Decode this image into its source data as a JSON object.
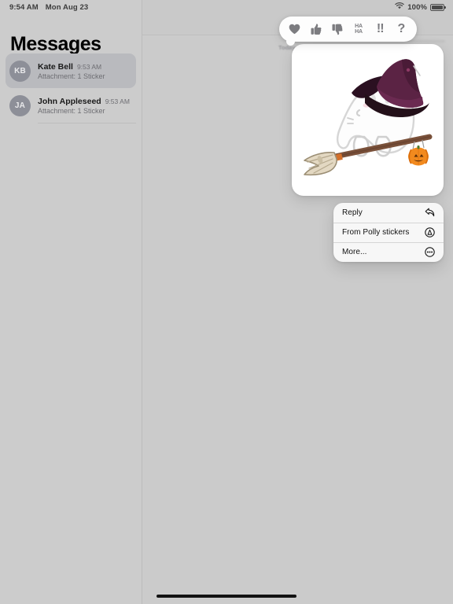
{
  "status_bar": {
    "time": "9:54 AM",
    "date": "Mon Aug 23",
    "battery_percent": "100%",
    "wifi_icon": "wifi-icon",
    "battery_icon": "battery-full-icon"
  },
  "sidebar": {
    "title": "Messages",
    "conversations": [
      {
        "initials": "KB",
        "name": "Kate Bell",
        "time": "9:53 AM",
        "preview": "Attachment: 1 Sticker",
        "selected": true
      },
      {
        "initials": "JA",
        "name": "John Appleseed",
        "time": "9:53 AM",
        "preview": "Attachment: 1 Sticker",
        "selected": false
      }
    ]
  },
  "conversation": {
    "day_stamp": "Today"
  },
  "tapback_bar": {
    "options": [
      {
        "id": "heart",
        "icon": "heart-icon",
        "label": "Love"
      },
      {
        "id": "thumbsup",
        "icon": "thumbs-up-icon",
        "label": "Like"
      },
      {
        "id": "thumbsdown",
        "icon": "thumbs-down-icon",
        "label": "Dislike"
      },
      {
        "id": "haha",
        "icon": "haha-icon",
        "line1": "HA",
        "line2": "HA",
        "label": "Haha"
      },
      {
        "id": "exclamation",
        "icon": "double-exclamation-icon",
        "glyph": "!!",
        "label": "Emphasize"
      },
      {
        "id": "question",
        "icon": "question-mark-icon",
        "glyph": "?",
        "label": "Question"
      }
    ]
  },
  "sticker": {
    "description": "ghost wearing purple witch hat riding broomstick with pumpkin",
    "colors": {
      "hat_crown": "#5b2344",
      "hat_brim": "#2a1020",
      "ghost_body": "#fdfdfd",
      "ghost_outline": "#d2d2d2",
      "broom_handle": "#7a513a",
      "broom_bristles": "#ded2bd",
      "pumpkin": "#f28a1e",
      "pumpkin_dark": "#d96d0d"
    }
  },
  "context_menu": {
    "items": [
      {
        "label": "Reply",
        "icon": "reply-arrow-icon"
      },
      {
        "label": "From Polly stickers",
        "icon": "app-store-icon"
      },
      {
        "label": "More...",
        "icon": "ellipsis-circle-icon"
      }
    ]
  },
  "home_indicator": {
    "name": "home-indicator"
  },
  "theme": {
    "background": "#cbcbcb",
    "sidebar_background": "#cccccc",
    "selected_row": "#b9babe",
    "card_white": "#ffffff",
    "menu_background": "#f7f7f7",
    "secondary_text": "#6e6e73"
  }
}
